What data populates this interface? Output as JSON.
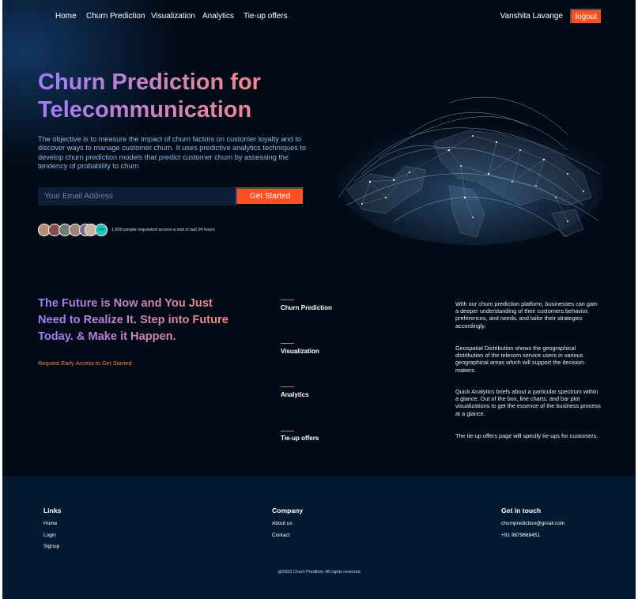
{
  "nav": {
    "links": [
      "Home",
      "Churn Prediction",
      "Visualization",
      "Analytics",
      "Tie-up offers"
    ],
    "user_name": "Vanshita Lavange",
    "logout_label": "logout"
  },
  "hero": {
    "title_line1": "Churn Prediction for",
    "title_line2": "Telecommunication",
    "description": "The objective is to measure the impact of churn factors on customer loyalty and to discover ways to manage customer churn. It uses predictive analytics techniques to develop churn prediction models that predict customer churn by assessing the tendency of probability to churn",
    "email_placeholder": "Your Email Address",
    "cta_label": "Get Started",
    "avatar_more_label": "+6k",
    "access_text": "1,600 people requested access a visit in last 24 hours"
  },
  "future": {
    "title": "The Future is Now and You Just Need to Realize It. Step into Future Today. & Make it Happen.",
    "link": "Request Early Access to Get Started"
  },
  "features": [
    {
      "name": "Churn Prediction",
      "description": "With our churn prediction platform, businesses can gain a deeper understanding of their customers behavior, preferences, and needs, and tailor their strategies accordingly."
    },
    {
      "name": "Visualization",
      "description": "Geospatial Distribution shows the geographical distribution of the telecom service users in various geographical areas which will support the decision-makers."
    },
    {
      "name": "Analytics",
      "description": "Quick Analytics briefs about a particular spectrum within a glance. Out of the box, line charts, and bar plot visualizations to get the essence of the business process at a glance."
    },
    {
      "name": "Tie-up offers",
      "description": "The tie-up offers page will specify tie-ups for customers."
    }
  ],
  "footer": {
    "links_heading": "Links",
    "links": [
      "Home",
      "Login",
      "Signup"
    ],
    "company_heading": "Company",
    "company": [
      "About us",
      "Contact"
    ],
    "contact_heading": "Get in touch",
    "contact": [
      "chumprediction@gmail.com",
      "+91 9879868451"
    ],
    "copyright": "@2023 Churn Predition. All rights reserved"
  },
  "colors": {
    "background": "#030b17",
    "accent": "#ff4e1f",
    "footer": "#041a33",
    "gradient_start": "#9d7dff",
    "gradient_end": "#ff8a7a"
  }
}
